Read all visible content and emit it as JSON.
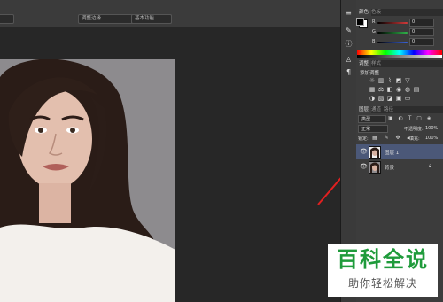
{
  "topbar": {
    "field1": "调整边缘...",
    "field2": "基本功能"
  },
  "color_panel": {
    "tabs": [
      "颜色",
      "色板"
    ],
    "channels": [
      {
        "label": "R",
        "value": "0",
        "color": "#d33a3a"
      },
      {
        "label": "G",
        "value": "0",
        "color": "#2fb34a"
      },
      {
        "label": "B",
        "value": "0",
        "color": "#3b63d8"
      }
    ]
  },
  "adjust_panel": {
    "tabs": [
      "调整",
      "样式"
    ],
    "title": "添加调整"
  },
  "layers_panel": {
    "tabs": [
      "图层",
      "通道",
      "路径"
    ],
    "kind_filter": "类型",
    "blend_mode": "正常",
    "opacity_label": "不透明度:",
    "opacity_value": "100%",
    "lock_label": "锁定:",
    "fill_label": "填充:",
    "fill_value": "100%",
    "layers": [
      {
        "name": "图层 1",
        "selected": true
      },
      {
        "name": "背景",
        "selected": false
      }
    ]
  },
  "watermark": {
    "title": "百科全说",
    "subtitle": "助你轻松解决"
  },
  "colors": {
    "panel": "#3c3c3c",
    "selected_layer": "#4b5878",
    "arrow": "#e02020",
    "watermark_green": "#1f9b3b"
  }
}
